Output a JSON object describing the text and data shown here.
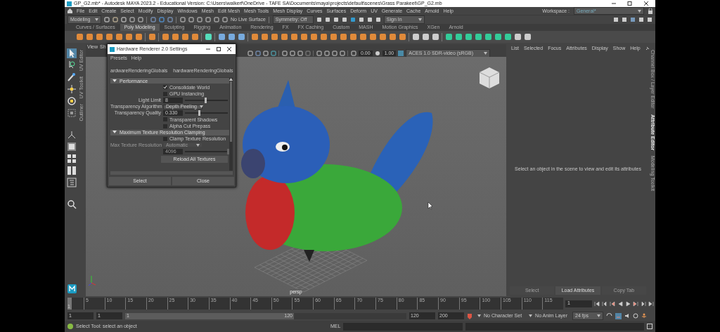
{
  "window": {
    "title": "GP_G2.mb* - Autodesk MAYA 2023.2 - Educational Version: C:\\Users\\walkerf\\OneDrive - TAFE SA\\Documents\\maya\\projects\\default\\scenes\\Grass Parakeet\\GP_G2.mb"
  },
  "menu_bar": {
    "items": [
      "File",
      "Edit",
      "Create",
      "Select",
      "Modify",
      "Display",
      "Windows",
      "Mesh",
      "Edit Mesh",
      "Mesh Tools",
      "Mesh Display",
      "Curves",
      "Surfaces",
      "Deform",
      "UV",
      "Generate",
      "Cache",
      "Arnold",
      "Help"
    ],
    "workspace_label": "Workspace :",
    "workspace": "General*"
  },
  "status_line": {
    "mode": "Modeling",
    "live_surface": "No Live Surface",
    "symmetry": "Symmetry: Off",
    "sign_in": "Sign In"
  },
  "shelf": {
    "tabs": [
      {
        "label": "Curves / Surfaces",
        "selected": false
      },
      {
        "label": "Poly Modeling",
        "selected": true
      },
      {
        "label": "Sculpting",
        "selected": false
      },
      {
        "label": "Rigging",
        "selected": false
      },
      {
        "label": "Animation",
        "selected": false
      },
      {
        "label": "Rendering",
        "selected": false
      },
      {
        "label": "FX",
        "selected": false
      },
      {
        "label": "FX Caching",
        "selected": false
      },
      {
        "label": "Custom",
        "selected": false
      },
      {
        "label": "MASH",
        "selected": false
      },
      {
        "label": "Motion Graphics",
        "selected": false
      },
      {
        "label": "XGen",
        "selected": false
      },
      {
        "label": "Arnold",
        "selected": false
      }
    ]
  },
  "toolbox": [
    {
      "kind": "select",
      "selected": true
    },
    {
      "kind": "lasso",
      "selected": false
    },
    {
      "kind": "paint",
      "selected": false
    },
    {
      "kind": "move",
      "selected": false
    },
    {
      "kind": "rotate",
      "selected": false
    },
    {
      "kind": "scale",
      "selected": false
    },
    {
      "kind": "axis",
      "selected": false
    },
    {
      "kind": "single",
      "selected": false
    },
    {
      "kind": "four",
      "selected": false
    },
    {
      "kind": "two",
      "selected": false
    },
    {
      "kind": "outliner",
      "selected": false
    },
    {
      "kind": "search",
      "selected": false
    }
  ],
  "side_tabs_left": [
    "UV Editor",
    "UV Toolkit",
    "Outliner"
  ],
  "viewport": {
    "menu": [
      "View",
      "Sh"
    ],
    "exposure": "0.00",
    "gamma": "1.00",
    "color_space": "ACES 1.0 SDR-video (sRGB)",
    "camera": "persp"
  },
  "render_settings_dialog": {
    "title": "Hardware Renderer 2.0 Settings",
    "menu": [
      "Presets",
      "Help"
    ],
    "node_tabs": [
      "ardwareRenderingGlobals",
      "hardwareRenderingGlobals"
    ],
    "sections": [
      {
        "title": "Performance",
        "expanded": true,
        "rows": [
          {
            "kind": "checkbox",
            "label": "Consolidate World",
            "checked": true,
            "disabled": false
          },
          {
            "kind": "checkbox",
            "label": "GPU Instancing",
            "checked": false,
            "disabled": false
          },
          {
            "kind": "slider",
            "label": "Light Limit",
            "value": "8",
            "level": 0.48,
            "disabled": false
          },
          {
            "kind": "dropdown",
            "label": "Transparency Algorithm",
            "value": "Depth Peeling",
            "disabled": false
          },
          {
            "kind": "slider",
            "label": "Transparency Quality",
            "value": "0.330",
            "level": 0.33,
            "disabled": false
          },
          {
            "kind": "checkbox",
            "label": "Transparent Shadows",
            "checked": false,
            "disabled": false
          },
          {
            "kind": "checkbox",
            "label": "Alpha Cut Prepass",
            "checked": false,
            "disabled": false
          }
        ]
      },
      {
        "title": "Maximum Texture Resolution Clamping",
        "expanded": true,
        "rows": [
          {
            "kind": "checkbox",
            "label": "Clamp Texture Resolution",
            "checked": false,
            "disabled": false
          },
          {
            "kind": "dropdown",
            "label": "Max Texture Resolution",
            "value": "Automatic",
            "disabled": true
          },
          {
            "kind": "slider",
            "value": "4096",
            "level": 1,
            "disabled": true
          },
          {
            "kind": "button",
            "label": "Reload All Textures",
            "disabled": false
          }
        ]
      }
    ],
    "buttons": [
      "Select",
      "Close"
    ]
  },
  "attribute_editor": {
    "menu": [
      "List",
      "Selected",
      "Focus",
      "Attributes",
      "Display",
      "Show",
      "Help"
    ],
    "message": "Select an object in the scene to view and edit its attributes",
    "buttons": [
      {
        "label": "Select",
        "disabled": true
      },
      {
        "label": "Load Attributes",
        "disabled": false
      },
      {
        "label": "Copy Tab",
        "disabled": true
      }
    ]
  },
  "side_tabs_right": [
    {
      "label": "Channel Box / Layer Editor",
      "selected": false
    },
    {
      "label": "Attribute Editor",
      "selected": true
    },
    {
      "label": "Modeling Toolkit",
      "selected": false
    }
  ],
  "time_slider": {
    "ticks": [
      "5",
      "10",
      "15",
      "20",
      "25",
      "30",
      "35",
      "40",
      "45",
      "50",
      "55",
      "60",
      "65",
      "70",
      "75",
      "80",
      "85",
      "90",
      "95",
      "100",
      "105",
      "110",
      "115"
    ],
    "current_frame": "1",
    "level": 0,
    "frame_field": "1"
  },
  "range_slider": {
    "start": "1",
    "playback_start": "1",
    "range_start": "1",
    "range_end": "120",
    "playback_end": "120",
    "end": "200",
    "level": 0.6,
    "character_set": "No Character Set",
    "anim_layer": "No Anim Layer",
    "fps": "24 fps"
  },
  "command_line": {
    "language": "MEL"
  },
  "help_line": "Select Tool: select an object"
}
